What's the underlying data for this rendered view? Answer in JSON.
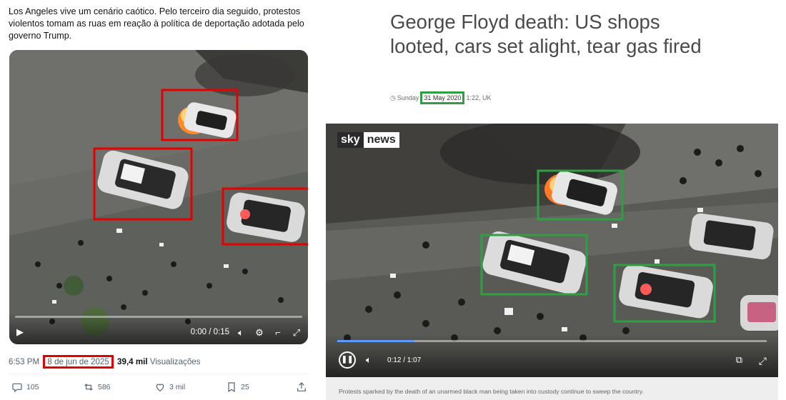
{
  "tweet": {
    "text": "Los Angeles vive um cenário caótico. Pelo terceiro dia seguido, protestos violentos tomam as ruas em reação à política de deportação adotada pelo governo Trump.",
    "video": {
      "time": "0:00 / 0:15",
      "progress": 0.0
    },
    "meta": {
      "time": "6:53 PM",
      "separator": "·",
      "date": "8 de jun de 2025",
      "views_count": "39,4 mil",
      "views_label": "Visualizações"
    },
    "actions": {
      "replies": "105",
      "reposts": "586",
      "likes": "3 mil",
      "bookmarks": "25"
    }
  },
  "article": {
    "headline": "George Floyd death: US shops looted, cars set alight, tear gas fired",
    "byline": {
      "day": "Sunday",
      "date": "31 May 2020",
      "time": "1:22, UK"
    },
    "video": {
      "logo_sky": "sky",
      "logo_news": "news",
      "time": "0:12 / 1:07",
      "progress": 0.18
    },
    "caption": "Protests sparked by the death of an unarmed black man being taken into custody continue to sweep the country."
  },
  "colors": {
    "tweet_highlight": "#e60000",
    "article_highlight": "#2ea043",
    "sky_progress": "#5b9bff"
  }
}
